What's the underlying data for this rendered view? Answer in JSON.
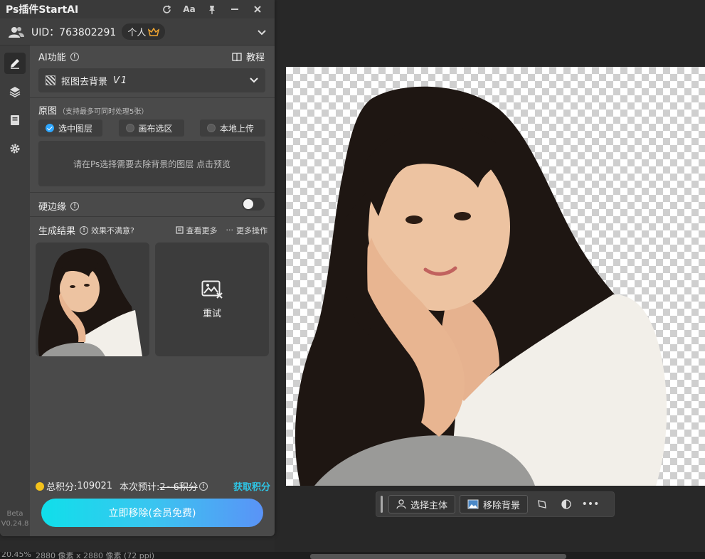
{
  "plugin": {
    "title": "Ps插件StartAI",
    "font_toggle_label": "Aa",
    "uid_text": "UID：763802291",
    "plan": "个人",
    "ai_label": "AI功能",
    "tutorial": "教程",
    "function": "抠图去背景",
    "function_version": "V1",
    "source_label": "原图",
    "source_hint": "（支持最多可同时处理5张）",
    "sources": [
      "选中图层",
      "画布选区",
      "本地上传"
    ],
    "selected_source": "选中图层",
    "drop_hint": "请在Ps选择需要去除背景的图层 点击预览",
    "hard_edge_label": "硬边缘",
    "hard_edge_on": false,
    "results_label": "生成结果",
    "dissatisfied": "效果不满意?",
    "view_more": "查看更多",
    "more_actions": "更多操作",
    "retry": "重试",
    "total_points_label": "总积分:",
    "total_points": "109021",
    "estimate_label": "本次预计:",
    "estimate_value": "2~6积分",
    "get_points": "获取积分",
    "cta": "立即移除(会员免费)",
    "beta": "Beta",
    "version": "V0.24.8"
  },
  "toolbar": {
    "select_subject": "选择主体",
    "remove_bg": "移除背景"
  },
  "status": {
    "zoom": "20.45%",
    "doc_size": "2880 像素 x 2880 像素 (72 ppi)"
  },
  "colors": {
    "accent": "#2ec6e6",
    "cta_start": "#10dfea",
    "cta_end": "#5a93f7",
    "panel_bg": "#4a4a4a"
  }
}
